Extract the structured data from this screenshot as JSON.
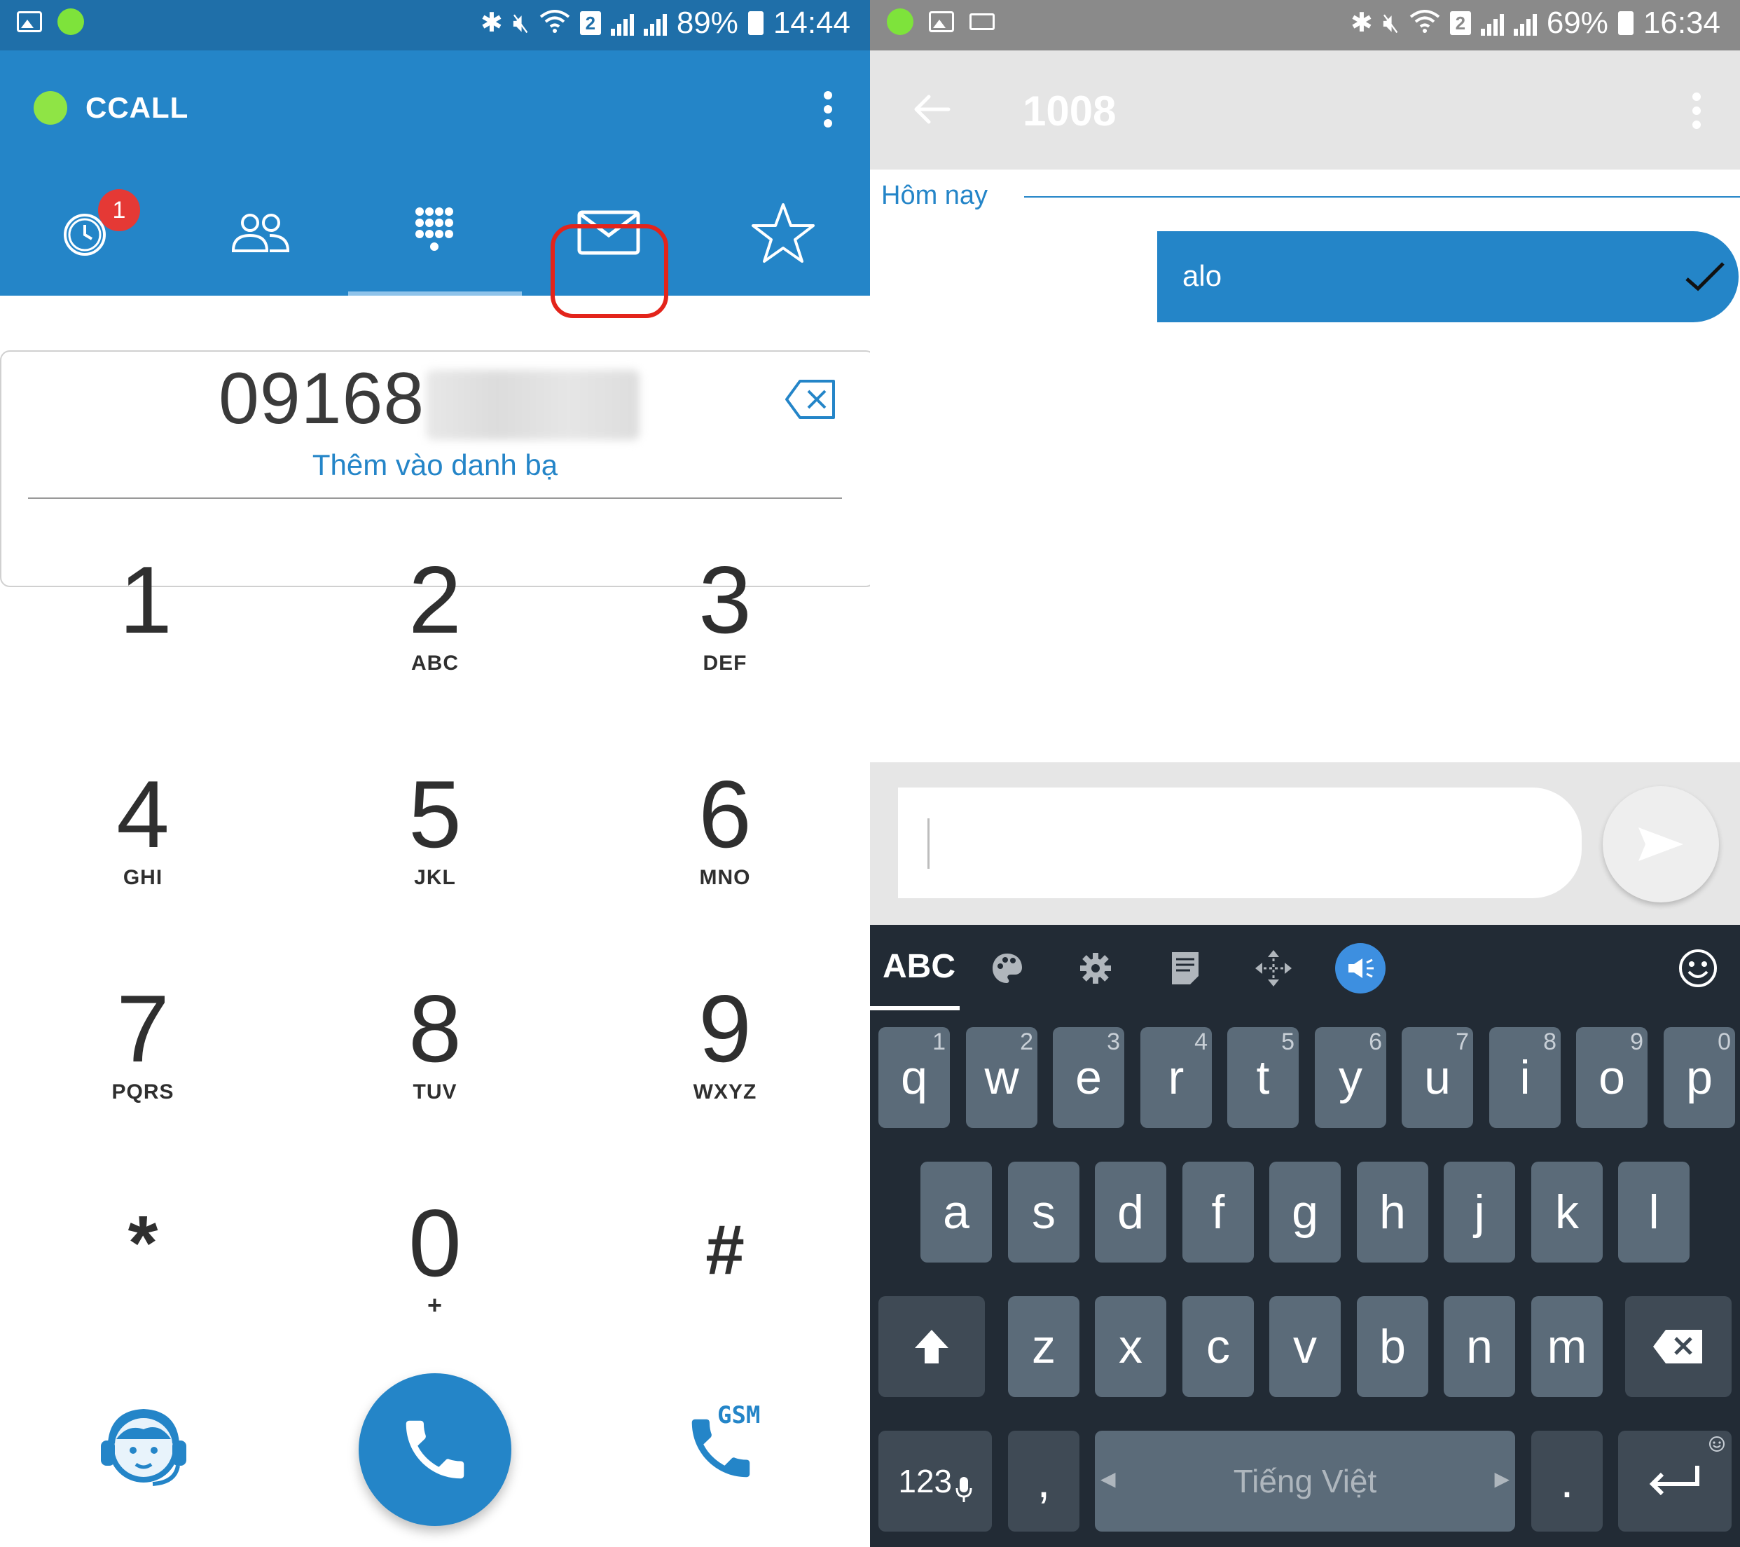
{
  "left": {
    "status": {
      "battery": "89%",
      "time": "14:44",
      "sim_badge": "2"
    },
    "app_title": "CCALL",
    "tabs": [
      {
        "name": "recents",
        "badge": "1"
      },
      {
        "name": "contacts"
      },
      {
        "name": "dialpad",
        "selected": true
      },
      {
        "name": "messages",
        "highlighted": true
      },
      {
        "name": "favorites"
      }
    ],
    "number": "09168",
    "add_contact": "Thêm vào danh bạ",
    "keys": [
      {
        "digit": "1",
        "letters": ""
      },
      {
        "digit": "2",
        "letters": "ABC"
      },
      {
        "digit": "3",
        "letters": "DEF"
      },
      {
        "digit": "4",
        "letters": "GHI"
      },
      {
        "digit": "5",
        "letters": "JKL"
      },
      {
        "digit": "6",
        "letters": "MNO"
      },
      {
        "digit": "7",
        "letters": "PQRS"
      },
      {
        "digit": "8",
        "letters": "TUV"
      },
      {
        "digit": "9",
        "letters": "WXYZ"
      },
      {
        "digit": "*",
        "letters": ""
      },
      {
        "digit": "0",
        "letters": "+"
      },
      {
        "digit": "#",
        "letters": ""
      }
    ],
    "gsm_label": "GSM"
  },
  "right": {
    "status": {
      "battery": "69%",
      "time": "16:34",
      "sim_badge": "2"
    },
    "title": "1008",
    "date_separator": "Hôm nay",
    "message": "alo",
    "keyboard": {
      "mode_label": "ABC",
      "row1": [
        {
          "c": "q",
          "h": "1"
        },
        {
          "c": "w",
          "h": "2"
        },
        {
          "c": "e",
          "h": "3"
        },
        {
          "c": "r",
          "h": "4"
        },
        {
          "c": "t",
          "h": "5"
        },
        {
          "c": "y",
          "h": "6"
        },
        {
          "c": "u",
          "h": "7"
        },
        {
          "c": "i",
          "h": "8"
        },
        {
          "c": "o",
          "h": "9"
        },
        {
          "c": "p",
          "h": "0"
        }
      ],
      "row2": [
        "a",
        "s",
        "d",
        "f",
        "g",
        "h",
        "j",
        "k",
        "l"
      ],
      "row3": [
        "z",
        "x",
        "c",
        "v",
        "b",
        "n",
        "m"
      ],
      "numbers_label": "123",
      "comma": ",",
      "space_label": "Tiếng Việt",
      "period": "."
    }
  },
  "colors": {
    "accent": "#2485c8",
    "status_left": "#1f6fa9",
    "status_right": "#8a8a8a",
    "keyboard_bg": "#222b35",
    "key_bg": "#5b6b79",
    "highlight": "#e3241b"
  }
}
